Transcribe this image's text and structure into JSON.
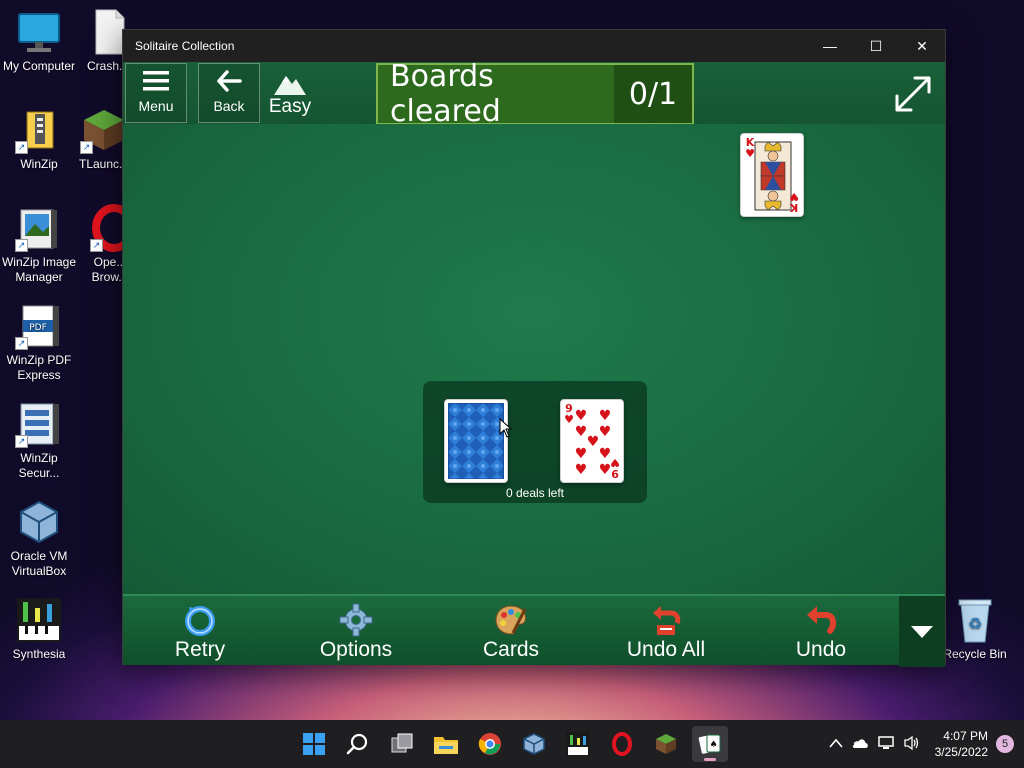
{
  "desktop_icons": [
    {
      "label": "My Computer"
    },
    {
      "label": "Crash..."
    },
    {
      "label": "WinZip"
    },
    {
      "label": "TLaunc..."
    },
    {
      "label": "WinZip Image Manager"
    },
    {
      "label": "Ope... Brow..."
    },
    {
      "label": "WinZip PDF Express"
    },
    {
      "label": "WinZip Secur..."
    },
    {
      "label": "Oracle VM VirtualBox"
    },
    {
      "label": "Synthesia"
    },
    {
      "label": "Recycle Bin"
    }
  ],
  "window": {
    "title": "Solitaire Collection",
    "controls": {
      "minimize": "—",
      "maximize": "☐",
      "close": "✕"
    }
  },
  "topbar": {
    "menu_label": "Menu",
    "back_label": "Back",
    "difficulty": "Easy",
    "boards_label": "Boards cleared",
    "boards_count": "0/1"
  },
  "board": {
    "foundation_card": {
      "rank": "K",
      "suit": "♥"
    },
    "waste_card": {
      "rank": "9",
      "suit": "♥"
    },
    "deals_left": "0 deals left"
  },
  "bottombar": {
    "retry": "Retry",
    "options": "Options",
    "cards": "Cards",
    "undo_all": "Undo All",
    "undo": "Undo"
  },
  "taskbar": {
    "time": "4:07 PM",
    "date": "3/25/2022",
    "notifications": "5"
  },
  "colors": {
    "felt": "#19693f",
    "topbar": "#155532",
    "boards_badge": "#2d6a1d",
    "heart_red": "#d6121a"
  }
}
